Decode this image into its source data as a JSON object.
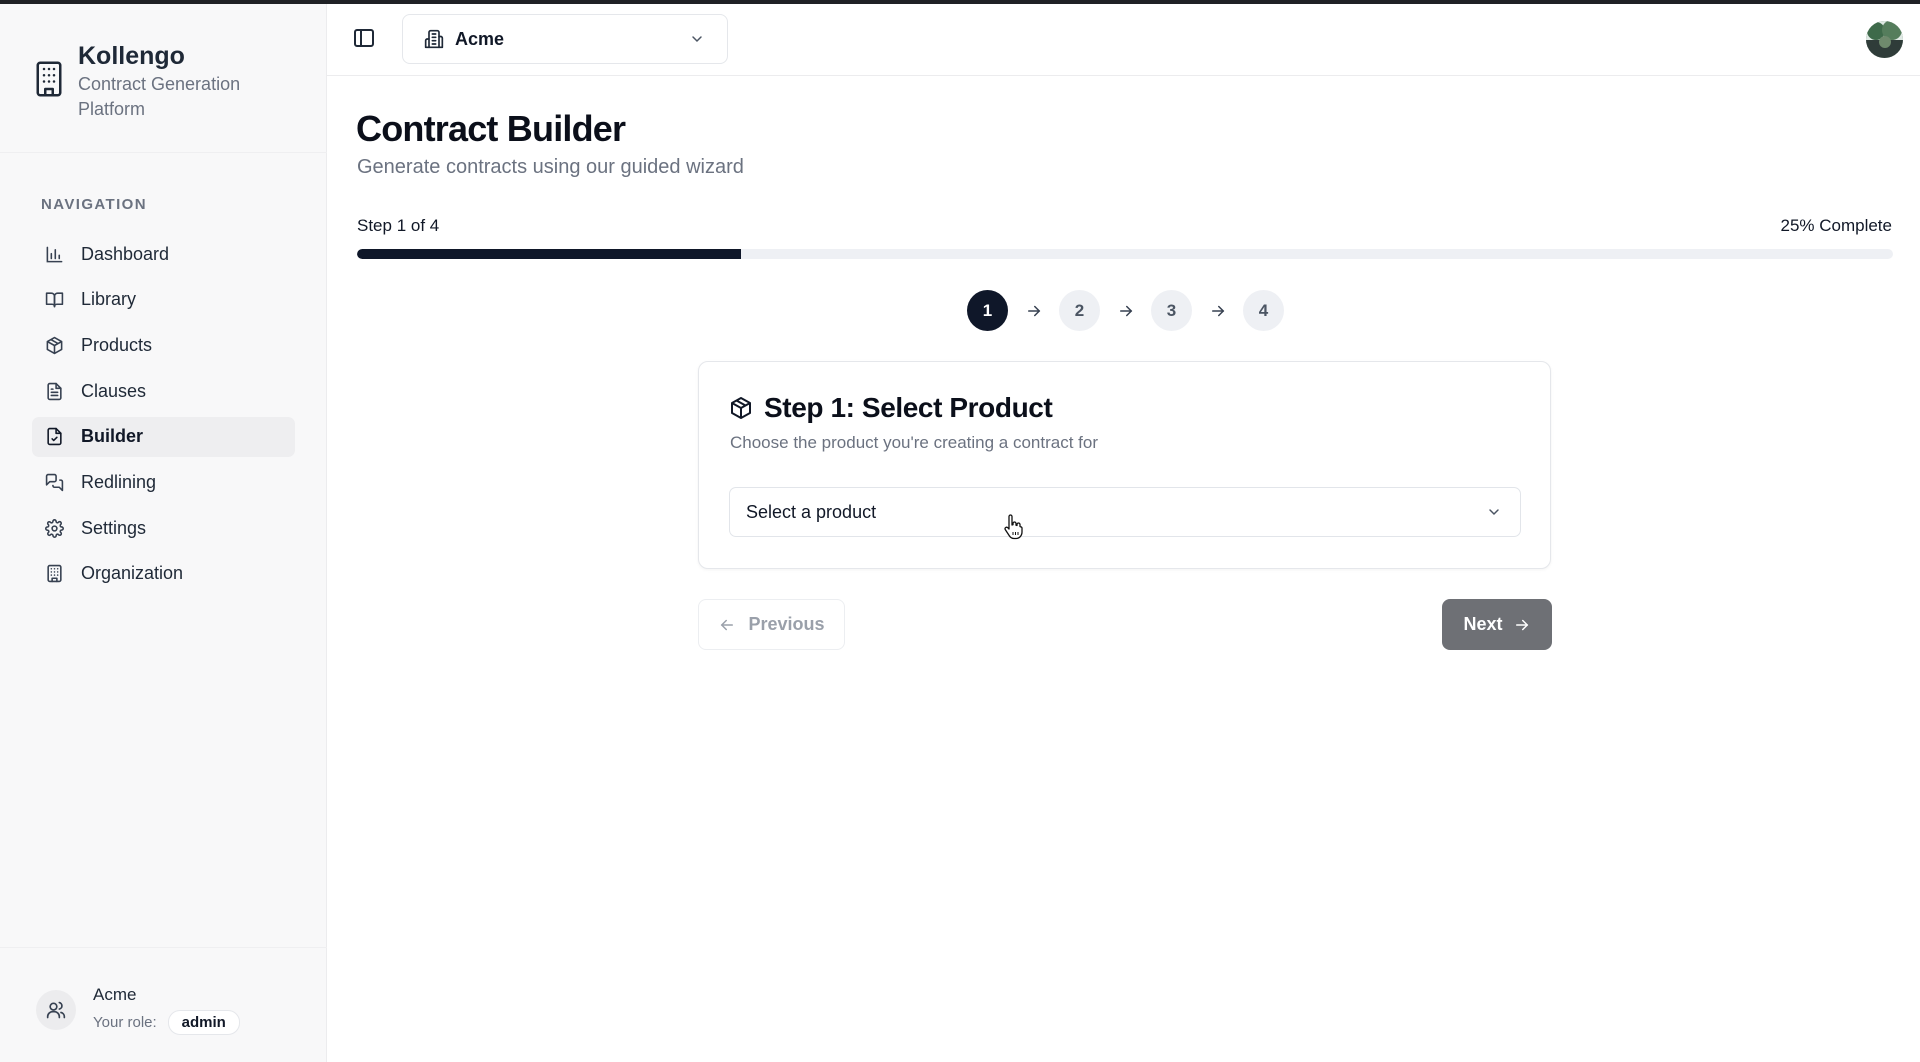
{
  "brand": {
    "name": "Kollengo",
    "subtitle": "Contract Generation Platform"
  },
  "sidebar": {
    "heading": "NAVIGATION",
    "items": [
      {
        "label": "Dashboard",
        "icon": "bar-chart-icon",
        "active": false
      },
      {
        "label": "Library",
        "icon": "book-icon",
        "active": false
      },
      {
        "label": "Products",
        "icon": "package-icon",
        "active": false
      },
      {
        "label": "Clauses",
        "icon": "file-text-icon",
        "active": false
      },
      {
        "label": "Builder",
        "icon": "file-check-icon",
        "active": true
      },
      {
        "label": "Redlining",
        "icon": "messages-icon",
        "active": false
      },
      {
        "label": "Settings",
        "icon": "gear-icon",
        "active": false
      },
      {
        "label": "Organization",
        "icon": "building-icon",
        "active": false
      }
    ],
    "footer": {
      "org_name": "Acme",
      "role_label": "Your role:",
      "role_value": "admin"
    }
  },
  "topbar": {
    "org_selected": "Acme"
  },
  "main": {
    "title": "Contract Builder",
    "subtitle": "Generate contracts using our guided wizard",
    "step_text": "Step 1 of 4",
    "progress_text": "25% Complete",
    "progress_fraction": 0.25,
    "steps": [
      "1",
      "2",
      "3",
      "4"
    ],
    "current_step": 1,
    "card": {
      "title": "Step 1: Select Product",
      "subtitle": "Choose the product you're creating a contract for",
      "select_placeholder": "Select a product"
    },
    "prev_label": "Previous",
    "next_label": "Next"
  },
  "colors": {
    "primary": "#0f1729",
    "next_button_disabled": "#6e7075",
    "sidebar_bg": "#f8f8f9",
    "muted_text": "#6b7280"
  }
}
